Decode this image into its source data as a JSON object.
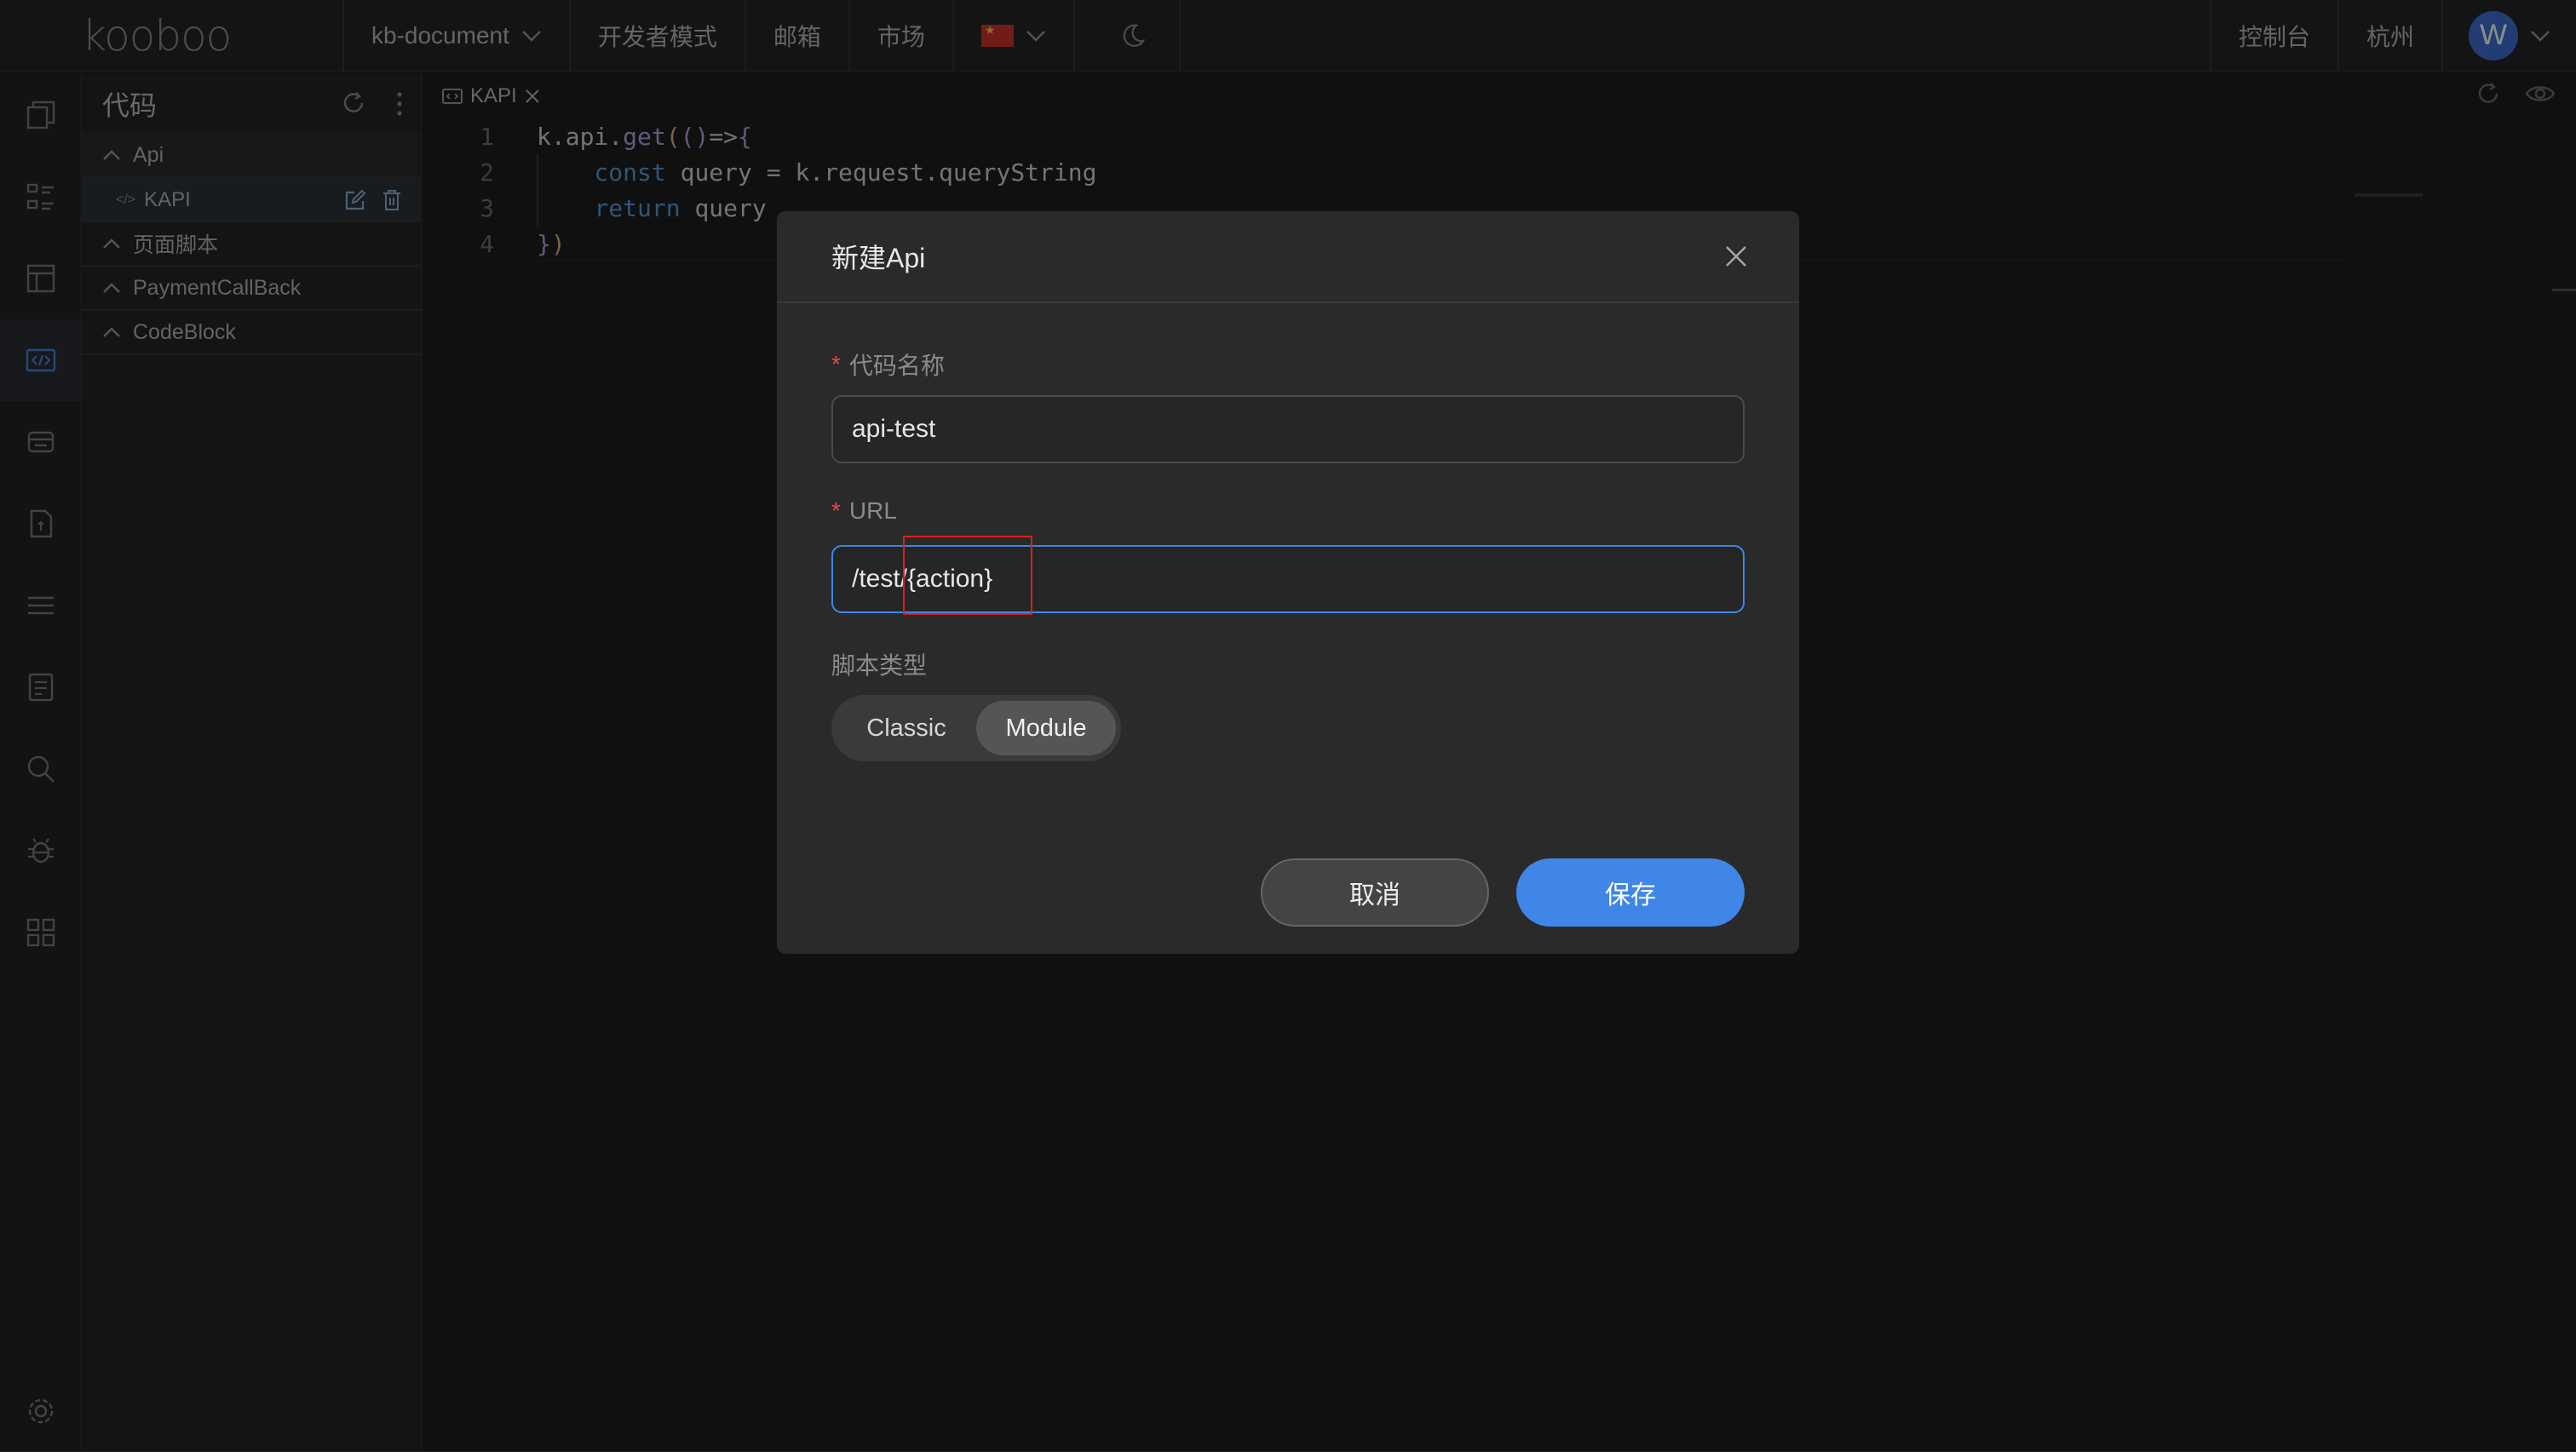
{
  "topbar": {
    "logo": "kooboo",
    "site_selector": "kb-document",
    "dev_mode": "开发者模式",
    "mail": "邮箱",
    "market": "市场",
    "console": "控制台",
    "region": "杭州",
    "avatar_letter": "W"
  },
  "tree": {
    "title": "代码",
    "groups": [
      {
        "label": "Api",
        "items": [
          {
            "label": "KAPI"
          }
        ]
      },
      {
        "label": "页面脚本"
      },
      {
        "label": "PaymentCallBack"
      },
      {
        "label": "CodeBlock"
      }
    ]
  },
  "editor": {
    "tab": "KAPI",
    "line_numbers": [
      "1",
      "2",
      "3",
      "4"
    ]
  },
  "modal": {
    "title": "新建Api",
    "name_label": "代码名称",
    "name_value": "api-test",
    "url_label": "URL",
    "url_value": "/test/{action}",
    "script_type_label": "脚本类型",
    "script_types": [
      "Classic",
      "Module"
    ],
    "script_type_selected": "Module",
    "cancel": "取消",
    "save": "保存"
  },
  "colors": {
    "accent": "#3f86e6",
    "required": "#e5484d",
    "highlight_box": "#d8201f"
  }
}
